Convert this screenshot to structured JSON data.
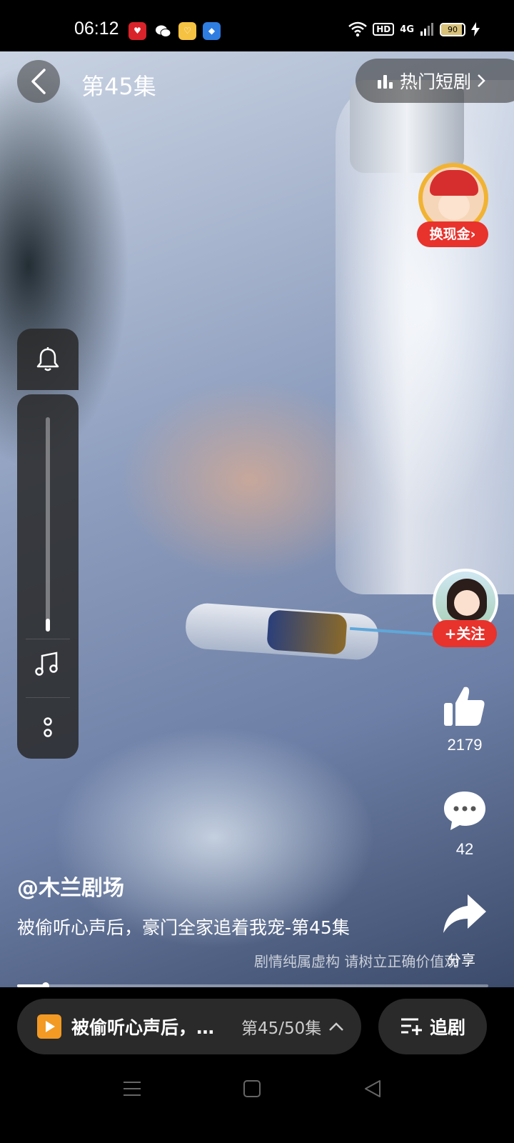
{
  "status_bar": {
    "time": "06:12",
    "app_icons": [
      "app-icon-red",
      "wechat-icon",
      "app-icon-yellow",
      "app-icon-blue"
    ],
    "network": "4G",
    "hd": "HD",
    "battery": "90"
  },
  "header": {
    "episode_title": "第45集",
    "hot_drama_label": "热门短剧"
  },
  "reward": {
    "label": "换现金"
  },
  "right_actions": {
    "follow_label": "+关注",
    "likes": "2179",
    "comments": "42",
    "share_label": "分享"
  },
  "caption": {
    "author": "@木兰剧场",
    "description": "被偷听心声后，豪门全家追着我宠-第45集",
    "disclaimer": "剧情纯属虚构 请树立正确价值观"
  },
  "player": {
    "progress": 0.06,
    "volume": 0.06
  },
  "bottom_bar": {
    "playlist_title": "被偷听心声后，…",
    "playlist_episode": "第45/50集",
    "chase_label": "追剧"
  },
  "colors": {
    "accent_red": "#e8322c",
    "playlist_orange": "#f29a24"
  }
}
